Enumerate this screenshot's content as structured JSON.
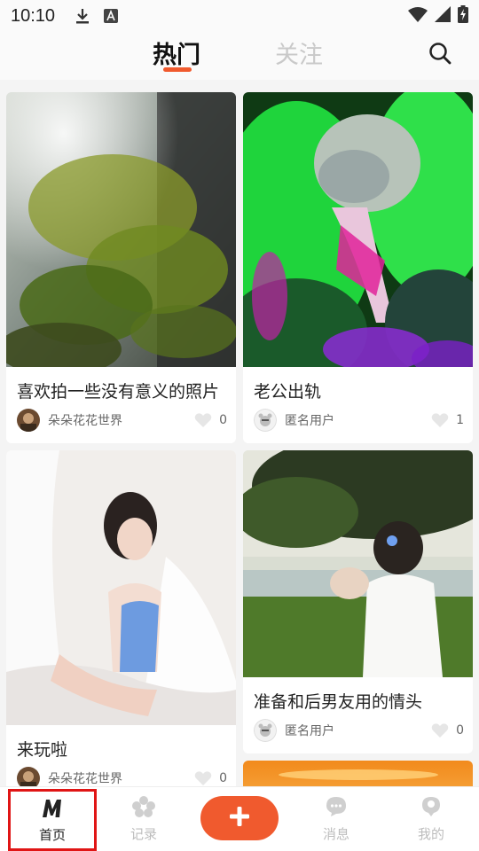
{
  "status_bar": {
    "time": "10:10",
    "icons": [
      "download-icon",
      "font-icon",
      "wifi-icon",
      "signal-icon",
      "battery-charging-icon"
    ]
  },
  "top_nav": {
    "tabs": [
      {
        "label": "热门",
        "active": true
      },
      {
        "label": "关注",
        "active": false
      }
    ],
    "search_icon": "search-icon",
    "accent": "#f05a2e"
  },
  "feed": {
    "posts": [
      {
        "title": "喜欢拍一些没有意义的照片",
        "author": "朵朵花花世界",
        "likes": "0",
        "image": "sunlit tree with sprinkler water"
      },
      {
        "title": "老公出轨",
        "author": "匿名用户",
        "likes": "1",
        "image": "green and magenta lit rock cave"
      },
      {
        "title": "来玩啦",
        "author": "朵朵花花世界",
        "likes": "0",
        "image": "woman in blue top on bed"
      },
      {
        "title": "准备和后男友用的情头",
        "author": "匿名用户",
        "likes": "0",
        "image": "woman holding glass jar by lake"
      },
      {
        "title": "",
        "author": "",
        "likes": "",
        "image": "orange sunset"
      }
    ]
  },
  "bottom_nav": {
    "items": [
      {
        "label": "首页",
        "icon": "m-logo-icon",
        "active": true
      },
      {
        "label": "记录",
        "icon": "flower-icon",
        "active": false
      },
      {
        "label": "",
        "icon": "plus-icon",
        "active": false
      },
      {
        "label": "消息",
        "icon": "chat-bubble-icon",
        "active": false
      },
      {
        "label": "我的",
        "icon": "profile-icon",
        "active": false
      }
    ],
    "highlight_color": "#e01515"
  }
}
